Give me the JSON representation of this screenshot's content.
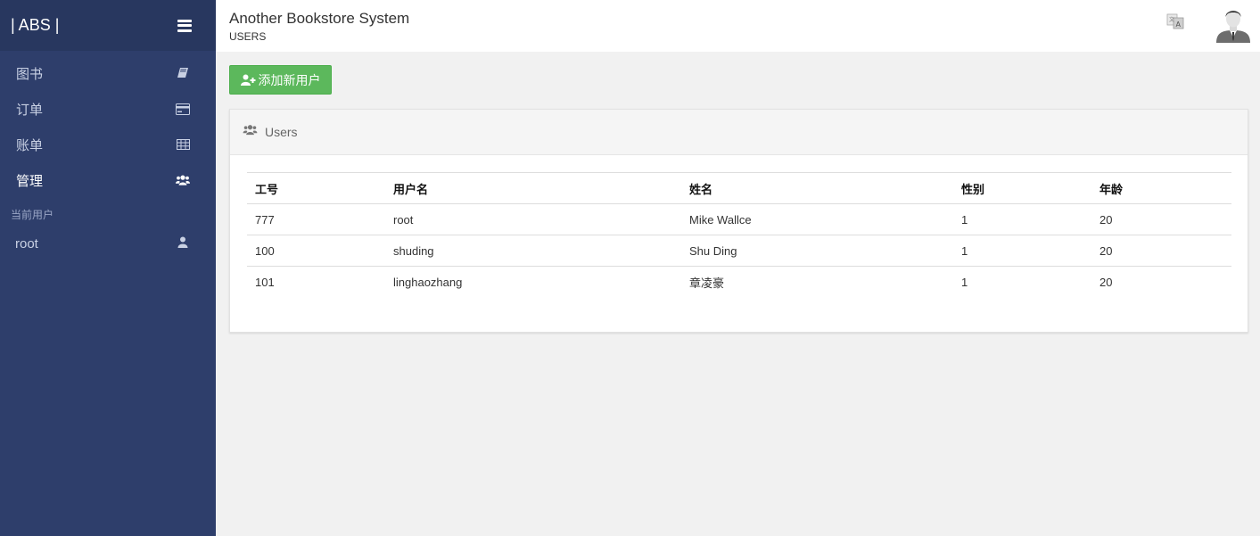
{
  "brand": "| ABS |",
  "sidebar": {
    "items": [
      {
        "label": "图书",
        "icon": "book-icon"
      },
      {
        "label": "订单",
        "icon": "credit-card-icon"
      },
      {
        "label": "账单",
        "icon": "table-icon"
      },
      {
        "label": "管理",
        "icon": "users-icon"
      }
    ],
    "section_label": "当前用户",
    "current_user": "root"
  },
  "header": {
    "title": "Another Bookstore System",
    "subtitle": "USERS"
  },
  "main": {
    "add_button_label": "添加新用户",
    "panel_title": "Users",
    "table": {
      "columns": [
        "工号",
        "用户名",
        "姓名",
        "性别",
        "年龄"
      ],
      "rows": [
        [
          "777",
          "root",
          "Mike Wallce",
          "1",
          "20"
        ],
        [
          "100",
          "shuding",
          "Shu Ding",
          "1",
          "20"
        ],
        [
          "101",
          "linghaozhang",
          "章凌豪",
          "1",
          "20"
        ]
      ]
    }
  },
  "colors": {
    "sidebar_bg": "#2e3e6b",
    "brand_bar_bg": "#28375f",
    "success": "#5cb85c"
  }
}
